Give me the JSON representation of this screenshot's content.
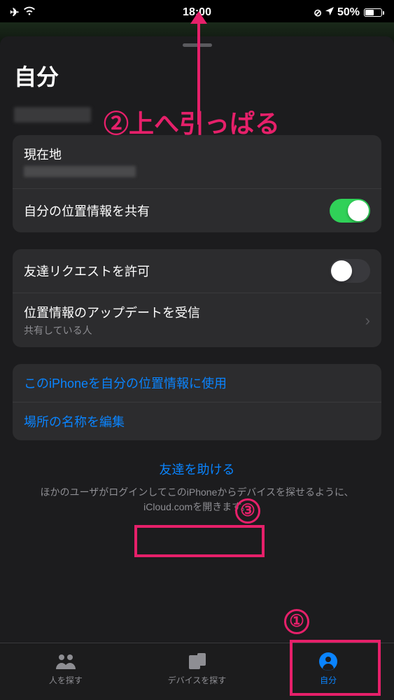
{
  "status": {
    "time": "18:00",
    "battery_pct": "50%"
  },
  "sheet": {
    "title": "自分"
  },
  "group1": {
    "location_label": "現在地",
    "share_label": "自分の位置情報を共有",
    "share_on": true
  },
  "group2": {
    "friend_req_label": "友達リクエストを許可",
    "friend_req_on": false,
    "updates_label": "位置情報のアップデートを受信",
    "updates_sub": "共有している人"
  },
  "group3": {
    "use_iphone_label": "このiPhoneを自分の位置情報に使用",
    "edit_place_label": "場所の名称を編集"
  },
  "help": {
    "link": "友達を助ける",
    "desc": "ほかのユーザがログインしてこのiPhoneからデバイスを探せるように、iCloud.comを開きます。"
  },
  "tabs": {
    "people": "人を探す",
    "devices": "デバイスを探す",
    "me": "自分"
  },
  "anno": {
    "t2": "②上へ引っぱる",
    "t3": "③",
    "t1": "①"
  }
}
